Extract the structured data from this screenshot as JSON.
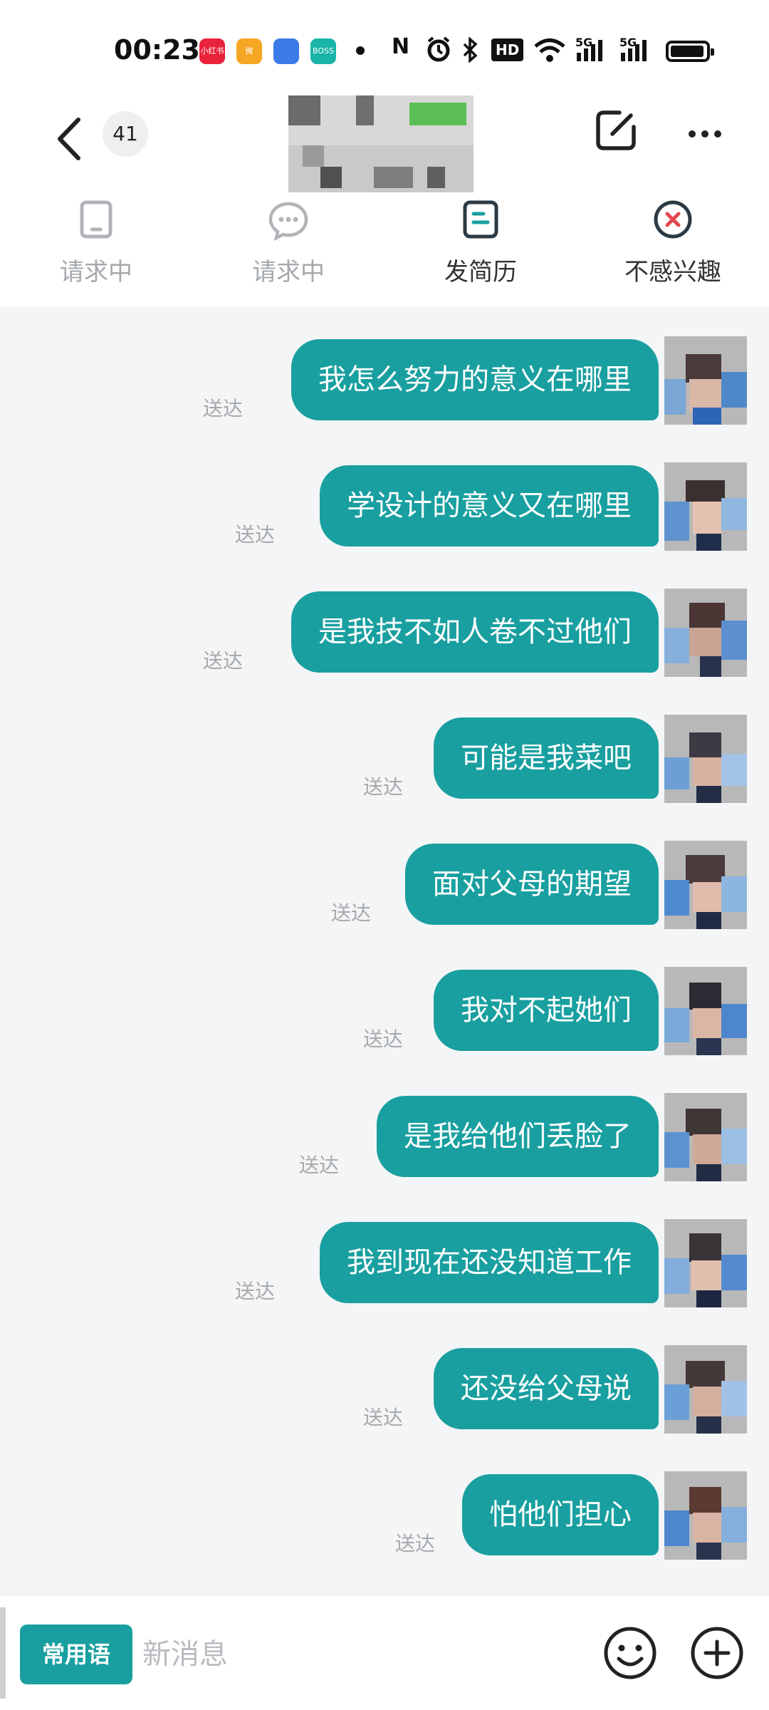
{
  "status_bar": {
    "time": "00:23",
    "apps": [
      {
        "icon": "xiaohongshu-icon",
        "text": "小红书",
        "color": "#e8233a"
      },
      {
        "icon": "weibo-icon",
        "text": "微",
        "color": "#f5a623"
      },
      {
        "icon": "security-app-icon",
        "text": "",
        "color": "#3b7be8"
      },
      {
        "icon": "boss-zhipin-icon",
        "text": "BOSS",
        "color": "#19b5a8"
      }
    ],
    "indicators": [
      "nfc-icon",
      "alarm-icon",
      "bluetooth-icon",
      "hd-icon",
      "wifi-icon",
      "signal-5g-icon",
      "signal-5g-icon",
      "battery-icon"
    ],
    "hd_label": "HD",
    "net_label": "5G"
  },
  "header": {
    "unread_count": "41",
    "title_blurred": true
  },
  "actions": [
    {
      "label": "请求中",
      "icon": "phone-icon",
      "state": "disabled"
    },
    {
      "label": "请求中",
      "icon": "chat-bubble-icon",
      "state": "disabled"
    },
    {
      "label": "发简历",
      "icon": "resume-icon",
      "state": "active"
    },
    {
      "label": "不感兴趣",
      "icon": "not-interested-icon",
      "state": "active"
    }
  ],
  "messages": [
    {
      "text": "我怎么努力的意义在哪里",
      "status": "送达"
    },
    {
      "text": "学设计的意义又在哪里",
      "status": "送达"
    },
    {
      "text": "是我技不如人卷不过他们",
      "status": "送达"
    },
    {
      "text": "可能是我菜吧",
      "status": "送达"
    },
    {
      "text": "面对父母的期望",
      "status": "送达"
    },
    {
      "text": "我对不起她们",
      "status": "送达"
    },
    {
      "text": "是我给他们丢脸了",
      "status": "送达"
    },
    {
      "text": "我到现在还没知道工作",
      "status": "送达"
    },
    {
      "text": "还没给父母说",
      "status": "送达"
    },
    {
      "text": "怕他们担心",
      "status": "送达"
    }
  ],
  "bottom_bar": {
    "quick_phrases": "常用语",
    "input_placeholder": "新消息"
  },
  "colors": {
    "accent": "#199fa0",
    "muted": "#a5a9ad",
    "danger": "#e5484d"
  }
}
